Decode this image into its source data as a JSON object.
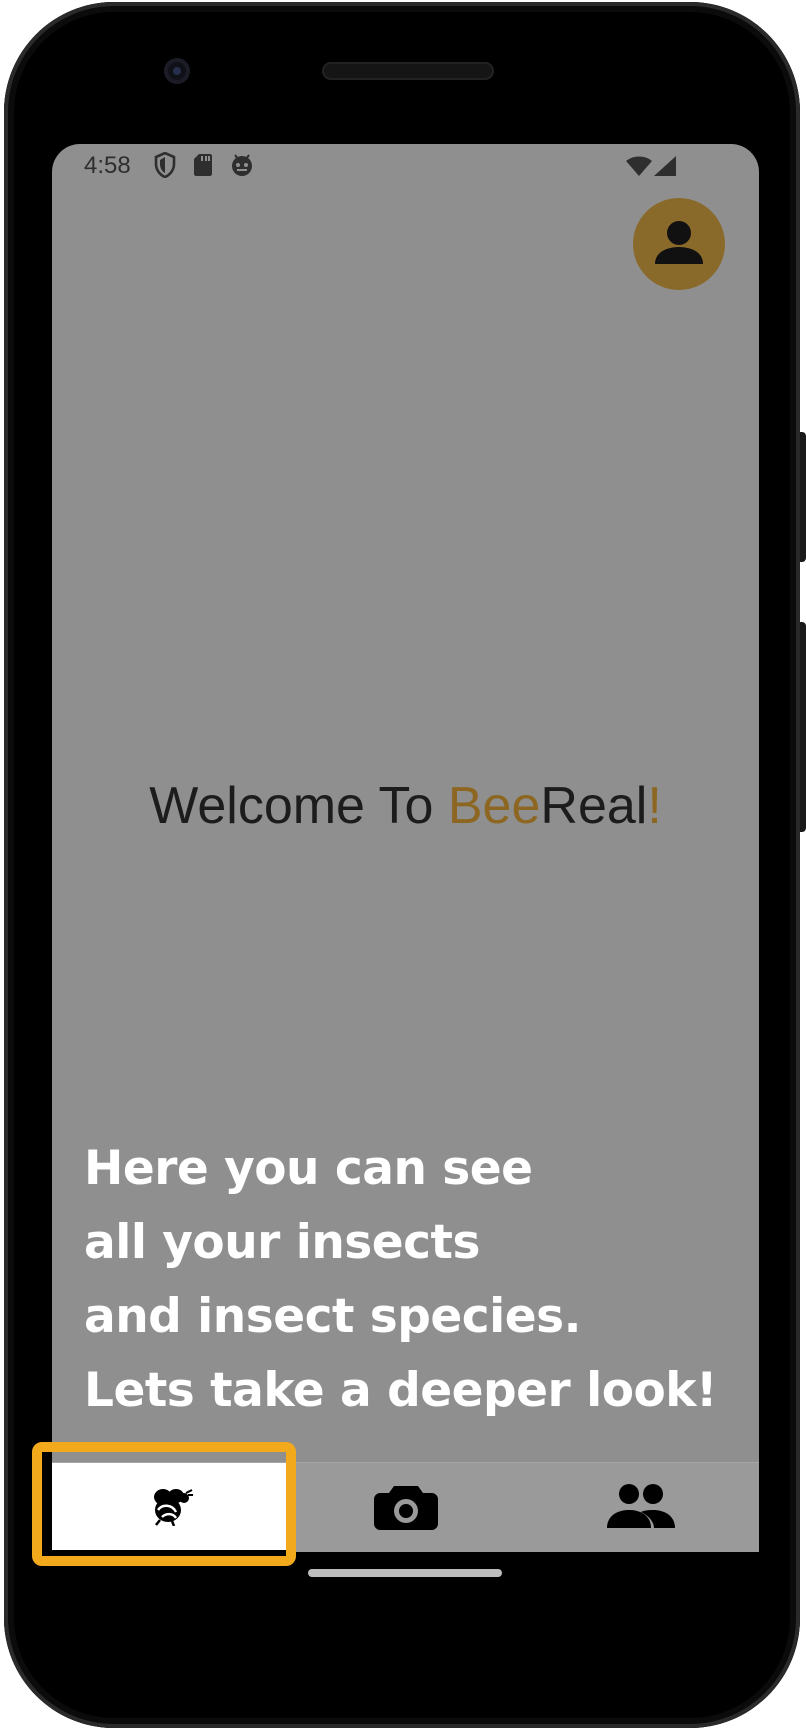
{
  "status_bar": {
    "time": "4:58",
    "icons": [
      "shield-icon",
      "sd-card-icon",
      "android-debug-icon",
      "wifi-icon",
      "cell-signal-icon"
    ]
  },
  "header": {
    "profile_icon": "person-icon",
    "profile_color": "#8a6a2a"
  },
  "welcome": {
    "part1": "Welcome To ",
    "part2": "Bee",
    "part3": "Real",
    "part4": "!",
    "accent_color": "#8d6722"
  },
  "info": {
    "lines": [
      "Here you can see",
      "all your insects",
      "and insect species.",
      "Lets take a deeper look!"
    ]
  },
  "bottom_nav": {
    "items": [
      {
        "icon": "bee-icon",
        "active": true
      },
      {
        "icon": "camera-icon",
        "active": false
      },
      {
        "icon": "people-icon",
        "active": false
      }
    ],
    "highlight_color": "#f2a91c"
  }
}
